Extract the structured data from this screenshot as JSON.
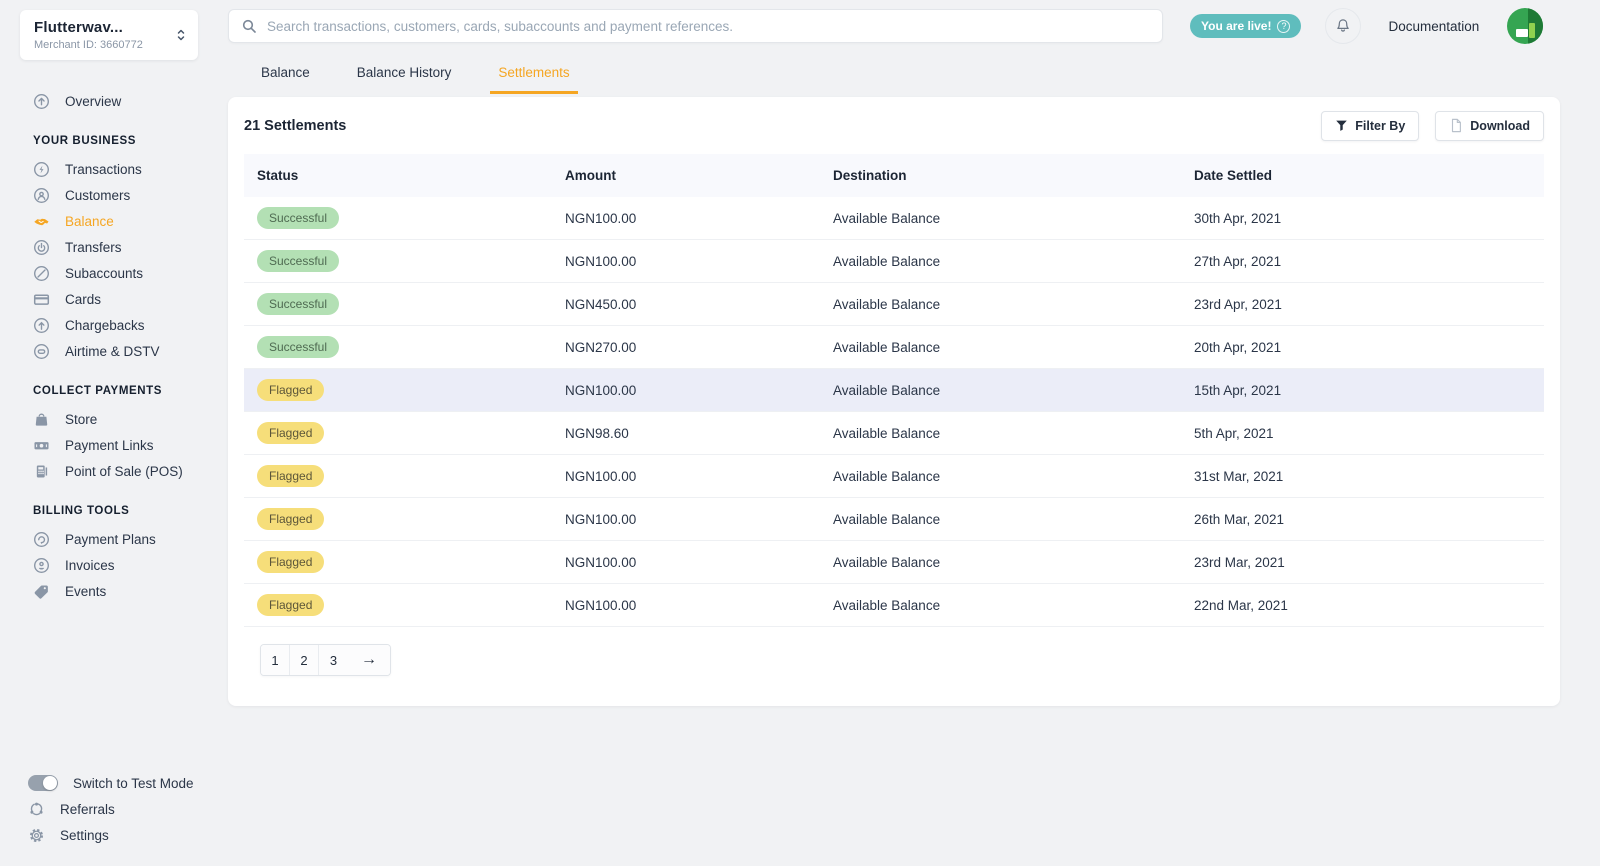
{
  "merchant": {
    "name": "Flutterwav...",
    "id_label": "Merchant ID: 3660772"
  },
  "topbar": {
    "search_placeholder": "Search transactions, customers, cards, subaccounts and payment references.",
    "live_badge": "You are live!",
    "documentation": "Documentation"
  },
  "sidebar": {
    "overview": {
      "label": "Overview",
      "icon": "overview-icon"
    },
    "sections": [
      {
        "title": "YOUR BUSINESS",
        "items": [
          {
            "label": "Transactions",
            "icon": "transactions-icon"
          },
          {
            "label": "Customers",
            "icon": "customers-icon"
          },
          {
            "label": "Balance",
            "icon": "balance-icon",
            "active": true
          },
          {
            "label": "Transfers",
            "icon": "transfers-icon"
          },
          {
            "label": "Subaccounts",
            "icon": "subaccounts-icon"
          },
          {
            "label": "Cards",
            "icon": "cards-icon"
          },
          {
            "label": "Chargebacks",
            "icon": "chargebacks-icon"
          },
          {
            "label": "Airtime & DSTV",
            "icon": "airtime-icon"
          }
        ]
      },
      {
        "title": "COLLECT PAYMENTS",
        "items": [
          {
            "label": "Store",
            "icon": "store-icon"
          },
          {
            "label": "Payment Links",
            "icon": "payment-links-icon"
          },
          {
            "label": "Point of Sale (POS)",
            "icon": "pos-icon"
          }
        ]
      },
      {
        "title": "BILLING TOOLS",
        "items": [
          {
            "label": "Payment Plans",
            "icon": "payment-plans-icon"
          },
          {
            "label": "Invoices",
            "icon": "invoices-icon"
          },
          {
            "label": "Events",
            "icon": "events-icon"
          }
        ]
      }
    ],
    "footer": {
      "test_mode_label": "Switch to Test Mode",
      "referrals_label": "Referrals",
      "settings_label": "Settings"
    }
  },
  "tabs": [
    {
      "label": "Balance"
    },
    {
      "label": "Balance History"
    },
    {
      "label": "Settlements",
      "active": true
    }
  ],
  "settlements": {
    "count_label": "21 Settlements",
    "filter_button": "Filter By",
    "download_button": "Download",
    "columns": [
      "Status",
      "Amount",
      "Destination",
      "Date Settled"
    ],
    "rows": [
      {
        "status": "Successful",
        "amount": "NGN100.00",
        "destination": "Available Balance",
        "date": "30th Apr, 2021"
      },
      {
        "status": "Successful",
        "amount": "NGN100.00",
        "destination": "Available Balance",
        "date": "27th Apr, 2021"
      },
      {
        "status": "Successful",
        "amount": "NGN450.00",
        "destination": "Available Balance",
        "date": "23rd Apr, 2021"
      },
      {
        "status": "Successful",
        "amount": "NGN270.00",
        "destination": "Available Balance",
        "date": "20th Apr, 2021"
      },
      {
        "status": "Flagged",
        "amount": "NGN100.00",
        "destination": "Available Balance",
        "date": "15th Apr, 2021",
        "highlighted": true
      },
      {
        "status": "Flagged",
        "amount": "NGN98.60",
        "destination": "Available Balance",
        "date": "5th Apr, 2021"
      },
      {
        "status": "Flagged",
        "amount": "NGN100.00",
        "destination": "Available Balance",
        "date": "31st Mar, 2021"
      },
      {
        "status": "Flagged",
        "amount": "NGN100.00",
        "destination": "Available Balance",
        "date": "26th Mar, 2021"
      },
      {
        "status": "Flagged",
        "amount": "NGN100.00",
        "destination": "Available Balance",
        "date": "23rd Mar, 2021"
      },
      {
        "status": "Flagged",
        "amount": "NGN100.00",
        "destination": "Available Balance",
        "date": "22nd Mar, 2021"
      }
    ],
    "pagination": {
      "pages": [
        "1",
        "2",
        "3"
      ],
      "next_label": "→"
    }
  },
  "colors": {
    "accent_orange": "#f5a623",
    "live_teal": "#5fbdbd",
    "success_badge_bg": "#b3e0b4",
    "flagged_badge_bg": "#f6de7a",
    "highlight_row_bg": "#ebedf8",
    "avatar_green": "#35a552"
  }
}
